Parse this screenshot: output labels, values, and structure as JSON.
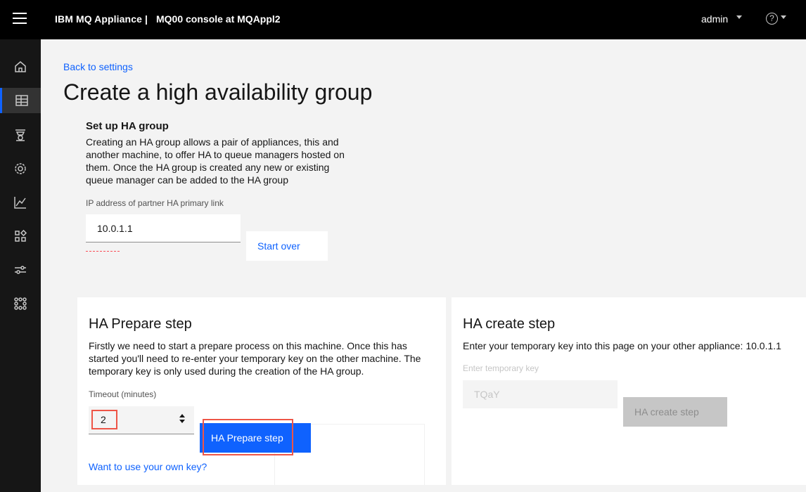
{
  "header": {
    "brand": "IBM MQ Appliance",
    "separator": "|",
    "console_title": "MQ00 console at MQAppl2",
    "user": "admin",
    "help_icon": "?"
  },
  "sidebar": {
    "items": [
      {
        "icon": "home-icon"
      },
      {
        "icon": "table-icon",
        "active": true
      },
      {
        "icon": "queue-manager-icon"
      },
      {
        "icon": "gear-icon"
      },
      {
        "icon": "chart-icon"
      },
      {
        "icon": "apps-icon"
      },
      {
        "icon": "sliders-icon"
      },
      {
        "icon": "network-icon"
      }
    ]
  },
  "page": {
    "back_link": "Back to settings",
    "title": "Create a high availability group"
  },
  "setup": {
    "heading": "Set up HA group",
    "description": "Creating an HA group allows a pair of appliances, this and another machine, to offer HA to queue managers hosted on them. Once the HA group is created any new or existing queue manager can be added to the HA group",
    "ip_label": "IP address of partner HA primary link",
    "ip_value": "10.0.1.1",
    "start_over": "Start over"
  },
  "prepare": {
    "title": "HA Prepare step",
    "description": "Firstly we need to start a prepare process on this machine. Once this has started you'll need to re-enter your temporary key on the other machine. The temporary key is only used during the creation of the HA group.",
    "timeout_label": "Timeout (minutes)",
    "timeout_value": "2",
    "button": "HA Prepare step",
    "own_key_link": "Want to use your own key?"
  },
  "create": {
    "title": "HA create step",
    "description": "Enter your temporary key into this page on your other appliance: 10.0.1.1",
    "tempkey_label": "Enter temporary key",
    "tempkey_value": "TQaY",
    "button": "HA create step"
  },
  "colors": {
    "accent": "#0f62fe",
    "highlight": "#ee5547",
    "header_bg": "#000000",
    "sidebar_bg": "#161616"
  }
}
